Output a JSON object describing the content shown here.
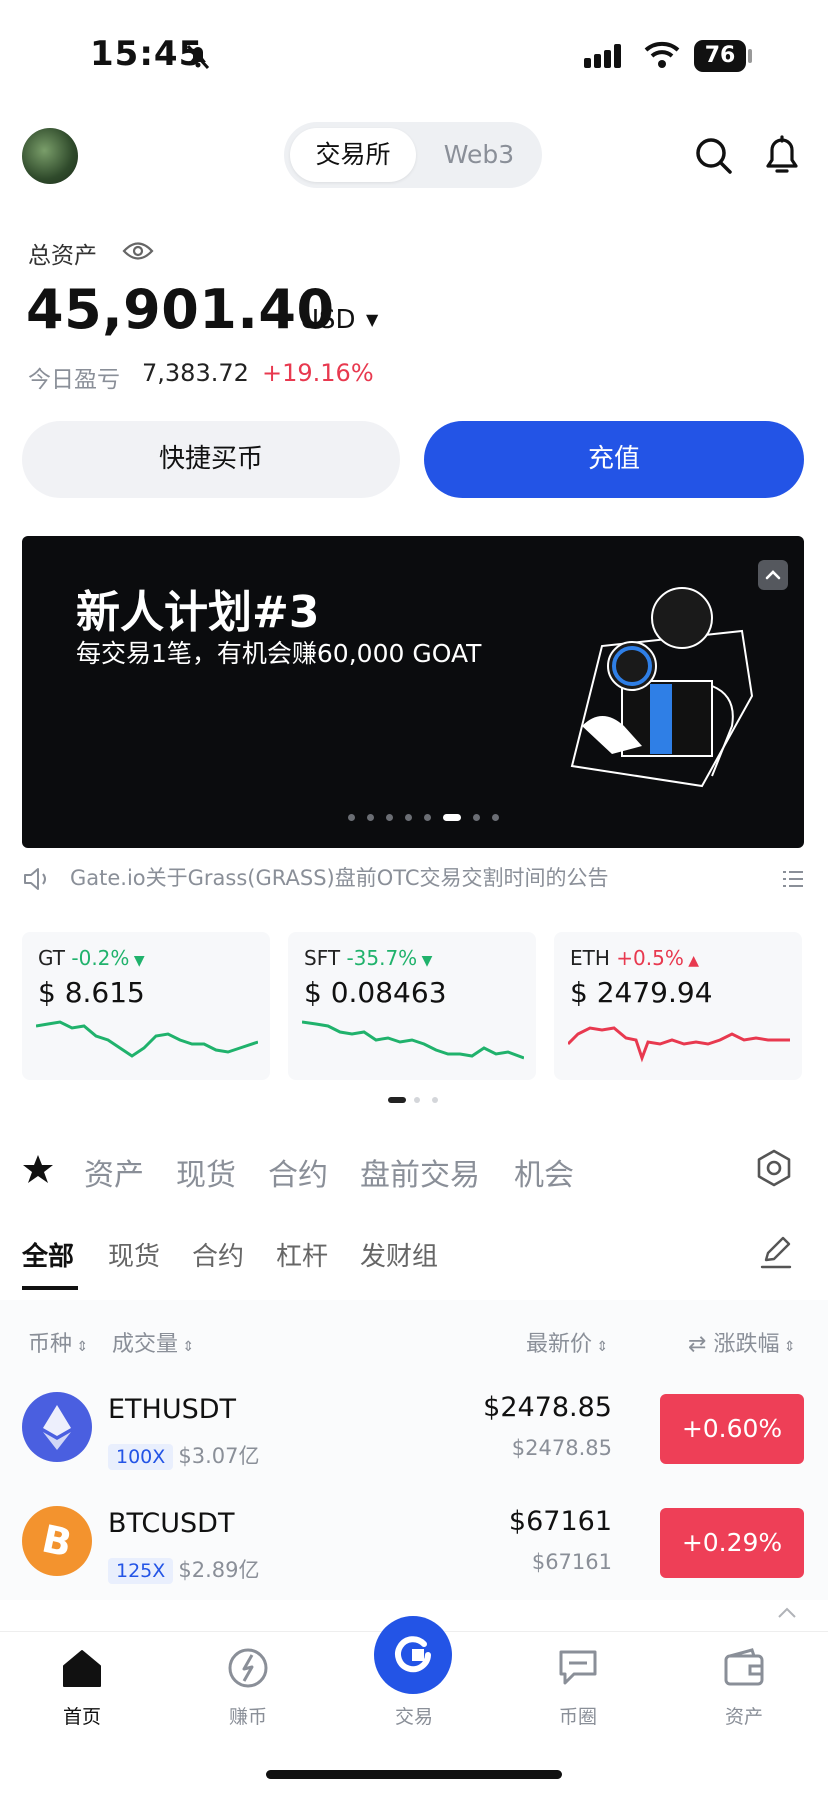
{
  "status": {
    "time": "15:45",
    "battery": "76"
  },
  "header": {
    "tab_exchange": "交易所",
    "tab_web3": "Web3"
  },
  "assets": {
    "label": "总资产",
    "value": "45,901.40",
    "currency": "USD",
    "pnl_label": "今日盈亏",
    "pnl_value": "7,383.72",
    "pnl_pct": "+19.16%"
  },
  "actions": {
    "quick_buy": "快捷买币",
    "deposit": "充值"
  },
  "banner": {
    "title": "新人计划#3",
    "subtitle": "每交易1笔，有机会赚60,000 GOAT",
    "active_index": 5,
    "count": 8
  },
  "announcement": {
    "text": "Gate.io关于Grass(GRASS)盘前OTC交易交割时间的公告"
  },
  "tickers": [
    {
      "symbol": "GT",
      "change": "-0.2%",
      "direction": "down",
      "price": "$ 8.615",
      "color": "#20b26c"
    },
    {
      "symbol": "SFT",
      "change": "-35.7%",
      "direction": "down",
      "price": "$ 0.08463",
      "color": "#20b26c"
    },
    {
      "symbol": "ETH",
      "change": "+0.5%",
      "direction": "up",
      "price": "$ 2479.94",
      "color": "#e8394f"
    }
  ],
  "categories": [
    "资产",
    "现货",
    "合约",
    "盘前交易",
    "机会"
  ],
  "subtabs": [
    "全部",
    "现货",
    "合约",
    "杠杆",
    "发财组"
  ],
  "columns": {
    "coin": "币种",
    "volume": "成交量",
    "last_price": "最新价",
    "change": "涨跌幅"
  },
  "rows": [
    {
      "pair": "ETHUSDT",
      "leverage": "100X",
      "volume": "$3.07亿",
      "price": "$2478.85",
      "sub_price": "$2478.85",
      "change": "+0.60%"
    },
    {
      "pair": "BTCUSDT",
      "leverage": "125X",
      "volume": "$2.89亿",
      "price": "$67161",
      "sub_price": "$67161",
      "change": "+0.29%"
    }
  ],
  "nav": [
    "首页",
    "赚币",
    "交易",
    "币圈",
    "资产"
  ]
}
